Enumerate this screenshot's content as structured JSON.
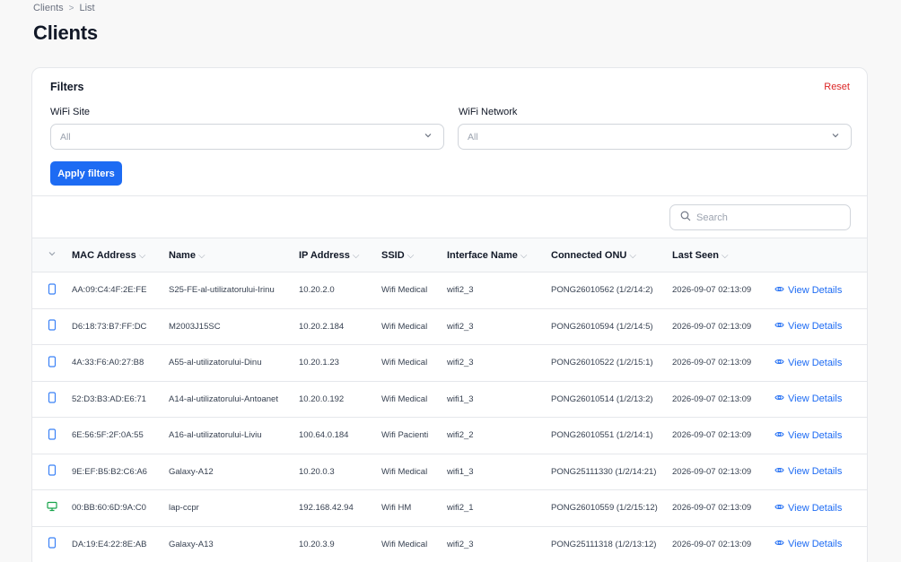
{
  "breadcrumb": {
    "parent": "Clients",
    "separator": ">",
    "current": "List"
  },
  "page": {
    "title": "Clients"
  },
  "filters": {
    "title": "Filters",
    "reset_label": "Reset",
    "wifi_site": {
      "label": "WiFi Site",
      "value": "All"
    },
    "wifi_network": {
      "label": "WiFi Network",
      "value": "All"
    },
    "apply_label": "Apply filters"
  },
  "search": {
    "placeholder": "Search"
  },
  "colors": {
    "accent": "#1d6bf3",
    "reset": "#dc2626",
    "phone_icon": "#3b82f6",
    "desktop_icon": "#16a34a"
  },
  "table": {
    "columns": {
      "mac": "MAC Address",
      "name": "Name",
      "ip": "IP Address",
      "ssid": "SSID",
      "iface": "Interface Name",
      "onu": "Connected ONU",
      "seen": "Last Seen"
    },
    "action_label": "View Details",
    "rows": [
      {
        "device": "phone-icon",
        "mac": "AA:09:C4:4F:2E:FE",
        "name": "S25-FE-al-utilizatorului-Irinu",
        "ip": "10.20.2.0",
        "ssid": "Wifi Medical",
        "iface": "wifi2_3",
        "onu": "PONG26010562 (1/2/14:2)",
        "seen": "2026-09-07 02:13:09"
      },
      {
        "device": "phone-icon",
        "mac": "D6:18:73:B7:FF:DC",
        "name": "M2003J15SC",
        "ip": "10.20.2.184",
        "ssid": "Wifi Medical",
        "iface": "wifi2_3",
        "onu": "PONG26010594 (1/2/14:5)",
        "seen": "2026-09-07 02:13:09"
      },
      {
        "device": "phone-icon",
        "mac": "4A:33:F6:A0:27:B8",
        "name": "A55-al-utilizatorului-Dinu",
        "ip": "10.20.1.23",
        "ssid": "Wifi Medical",
        "iface": "wifi2_3",
        "onu": "PONG26010522 (1/2/15:1)",
        "seen": "2026-09-07 02:13:09"
      },
      {
        "device": "phone-icon",
        "mac": "52:D3:B3:AD:E6:71",
        "name": "A14-al-utilizatorului-Antoanet",
        "ip": "10.20.0.192",
        "ssid": "Wifi Medical",
        "iface": "wifi1_3",
        "onu": "PONG26010514 (1/2/13:2)",
        "seen": "2026-09-07 02:13:09"
      },
      {
        "device": "phone-icon",
        "mac": "6E:56:5F:2F:0A:55",
        "name": "A16-al-utilizatorului-Liviu",
        "ip": "100.64.0.184",
        "ssid": "Wifi Pacienti",
        "iface": "wifi2_2",
        "onu": "PONG26010551 (1/2/14:1)",
        "seen": "2026-09-07 02:13:09"
      },
      {
        "device": "phone-icon",
        "mac": "9E:EF:B5:B2:C6:A6",
        "name": "Galaxy-A12",
        "ip": "10.20.0.3",
        "ssid": "Wifi Medical",
        "iface": "wifi1_3",
        "onu": "PONG25111330 (1/2/14:21)",
        "seen": "2026-09-07 02:13:09"
      },
      {
        "device": "desktop-icon",
        "mac": "00:BB:60:6D:9A:C0",
        "name": "lap-ccpr",
        "ip": "192.168.42.94",
        "ssid": "Wifi HM",
        "iface": "wifi2_1",
        "onu": "PONG26010559 (1/2/15:12)",
        "seen": "2026-09-07 02:13:09"
      },
      {
        "device": "phone-icon",
        "mac": "DA:19:E4:22:8E:AB",
        "name": "Galaxy-A13",
        "ip": "10.20.3.9",
        "ssid": "Wifi Medical",
        "iface": "wifi2_3",
        "onu": "PONG25111318 (1/2/13:12)",
        "seen": "2026-09-07 02:13:09"
      }
    ]
  }
}
